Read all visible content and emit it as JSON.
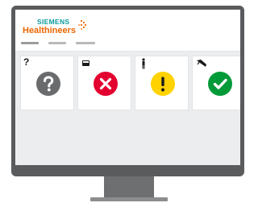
{
  "brand": {
    "line1": "SIEMENS",
    "line2": "Healthineers",
    "logo_dots_color": "#ec6602",
    "line1_color": "#0a9a9c",
    "line2_color": "#ec6602"
  },
  "nav": {
    "items": [
      "",
      "",
      ""
    ]
  },
  "tiles": [
    {
      "icon": "question-mark-icon",
      "icon_text": "?",
      "status": "unknown",
      "status_icon": "question-icon",
      "color": "#6a6b6d"
    },
    {
      "icon": "bed-icon",
      "status": "error",
      "status_icon": "x-icon",
      "color": "#e30030"
    },
    {
      "icon": "person-icon",
      "status": "warning",
      "status_icon": "exclamation-icon",
      "color": "#ffd200"
    },
    {
      "icon": "tilted-device-icon",
      "status": "ok",
      "status_icon": "checkmark-icon",
      "color": "#009a38"
    }
  ]
}
